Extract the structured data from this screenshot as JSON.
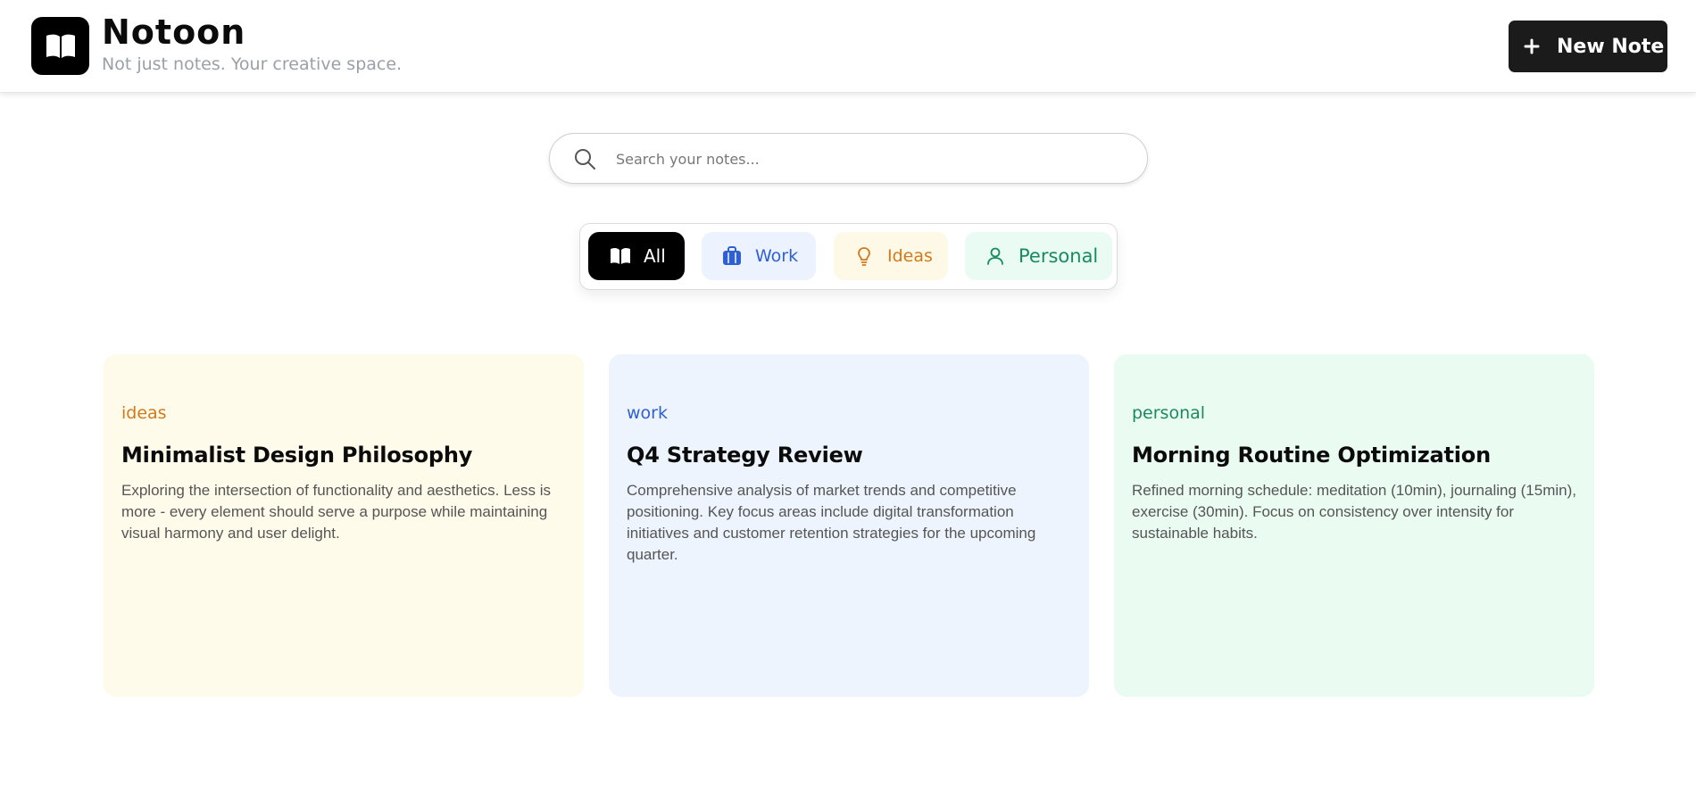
{
  "header": {
    "title": "Notoon",
    "tagline": "Not just notes. Your creative space.",
    "new_note_label": "New Note",
    "logo_icon": "open-book-icon"
  },
  "search": {
    "placeholder": "Search your notes...",
    "value": ""
  },
  "filters": {
    "selected": "All",
    "tabs": [
      {
        "label": "All",
        "icon": "open-book-icon"
      },
      {
        "label": "Work",
        "icon": "briefcase-icon"
      },
      {
        "label": "Ideas",
        "icon": "lightbulb-icon"
      },
      {
        "label": "Personal",
        "icon": "user-icon"
      }
    ]
  },
  "notes": [
    {
      "category": "ideas",
      "title": "Minimalist Design Philosophy",
      "body": "Exploring the intersection of functionality and aesthetics. Less is more - every element should serve a purpose while maintaining visual harmony and user delight."
    },
    {
      "category": "work",
      "title": "Q4 Strategy Review",
      "body": "Comprehensive analysis of market trends and competitive positioning. Key focus areas include digital transformation initiatives and customer retention strategies for the upcoming quarter."
    },
    {
      "category": "personal",
      "title": "Morning Routine Optimization",
      "body": "Refined morning schedule: meditation (10min), journaling (15min), exercise (30min). Focus on consistency over intensity for sustainable habits."
    }
  ],
  "colors": {
    "ideas": "#d3791a",
    "work": "#2f5fd8",
    "personal": "#198a62",
    "primary": "#000000"
  }
}
